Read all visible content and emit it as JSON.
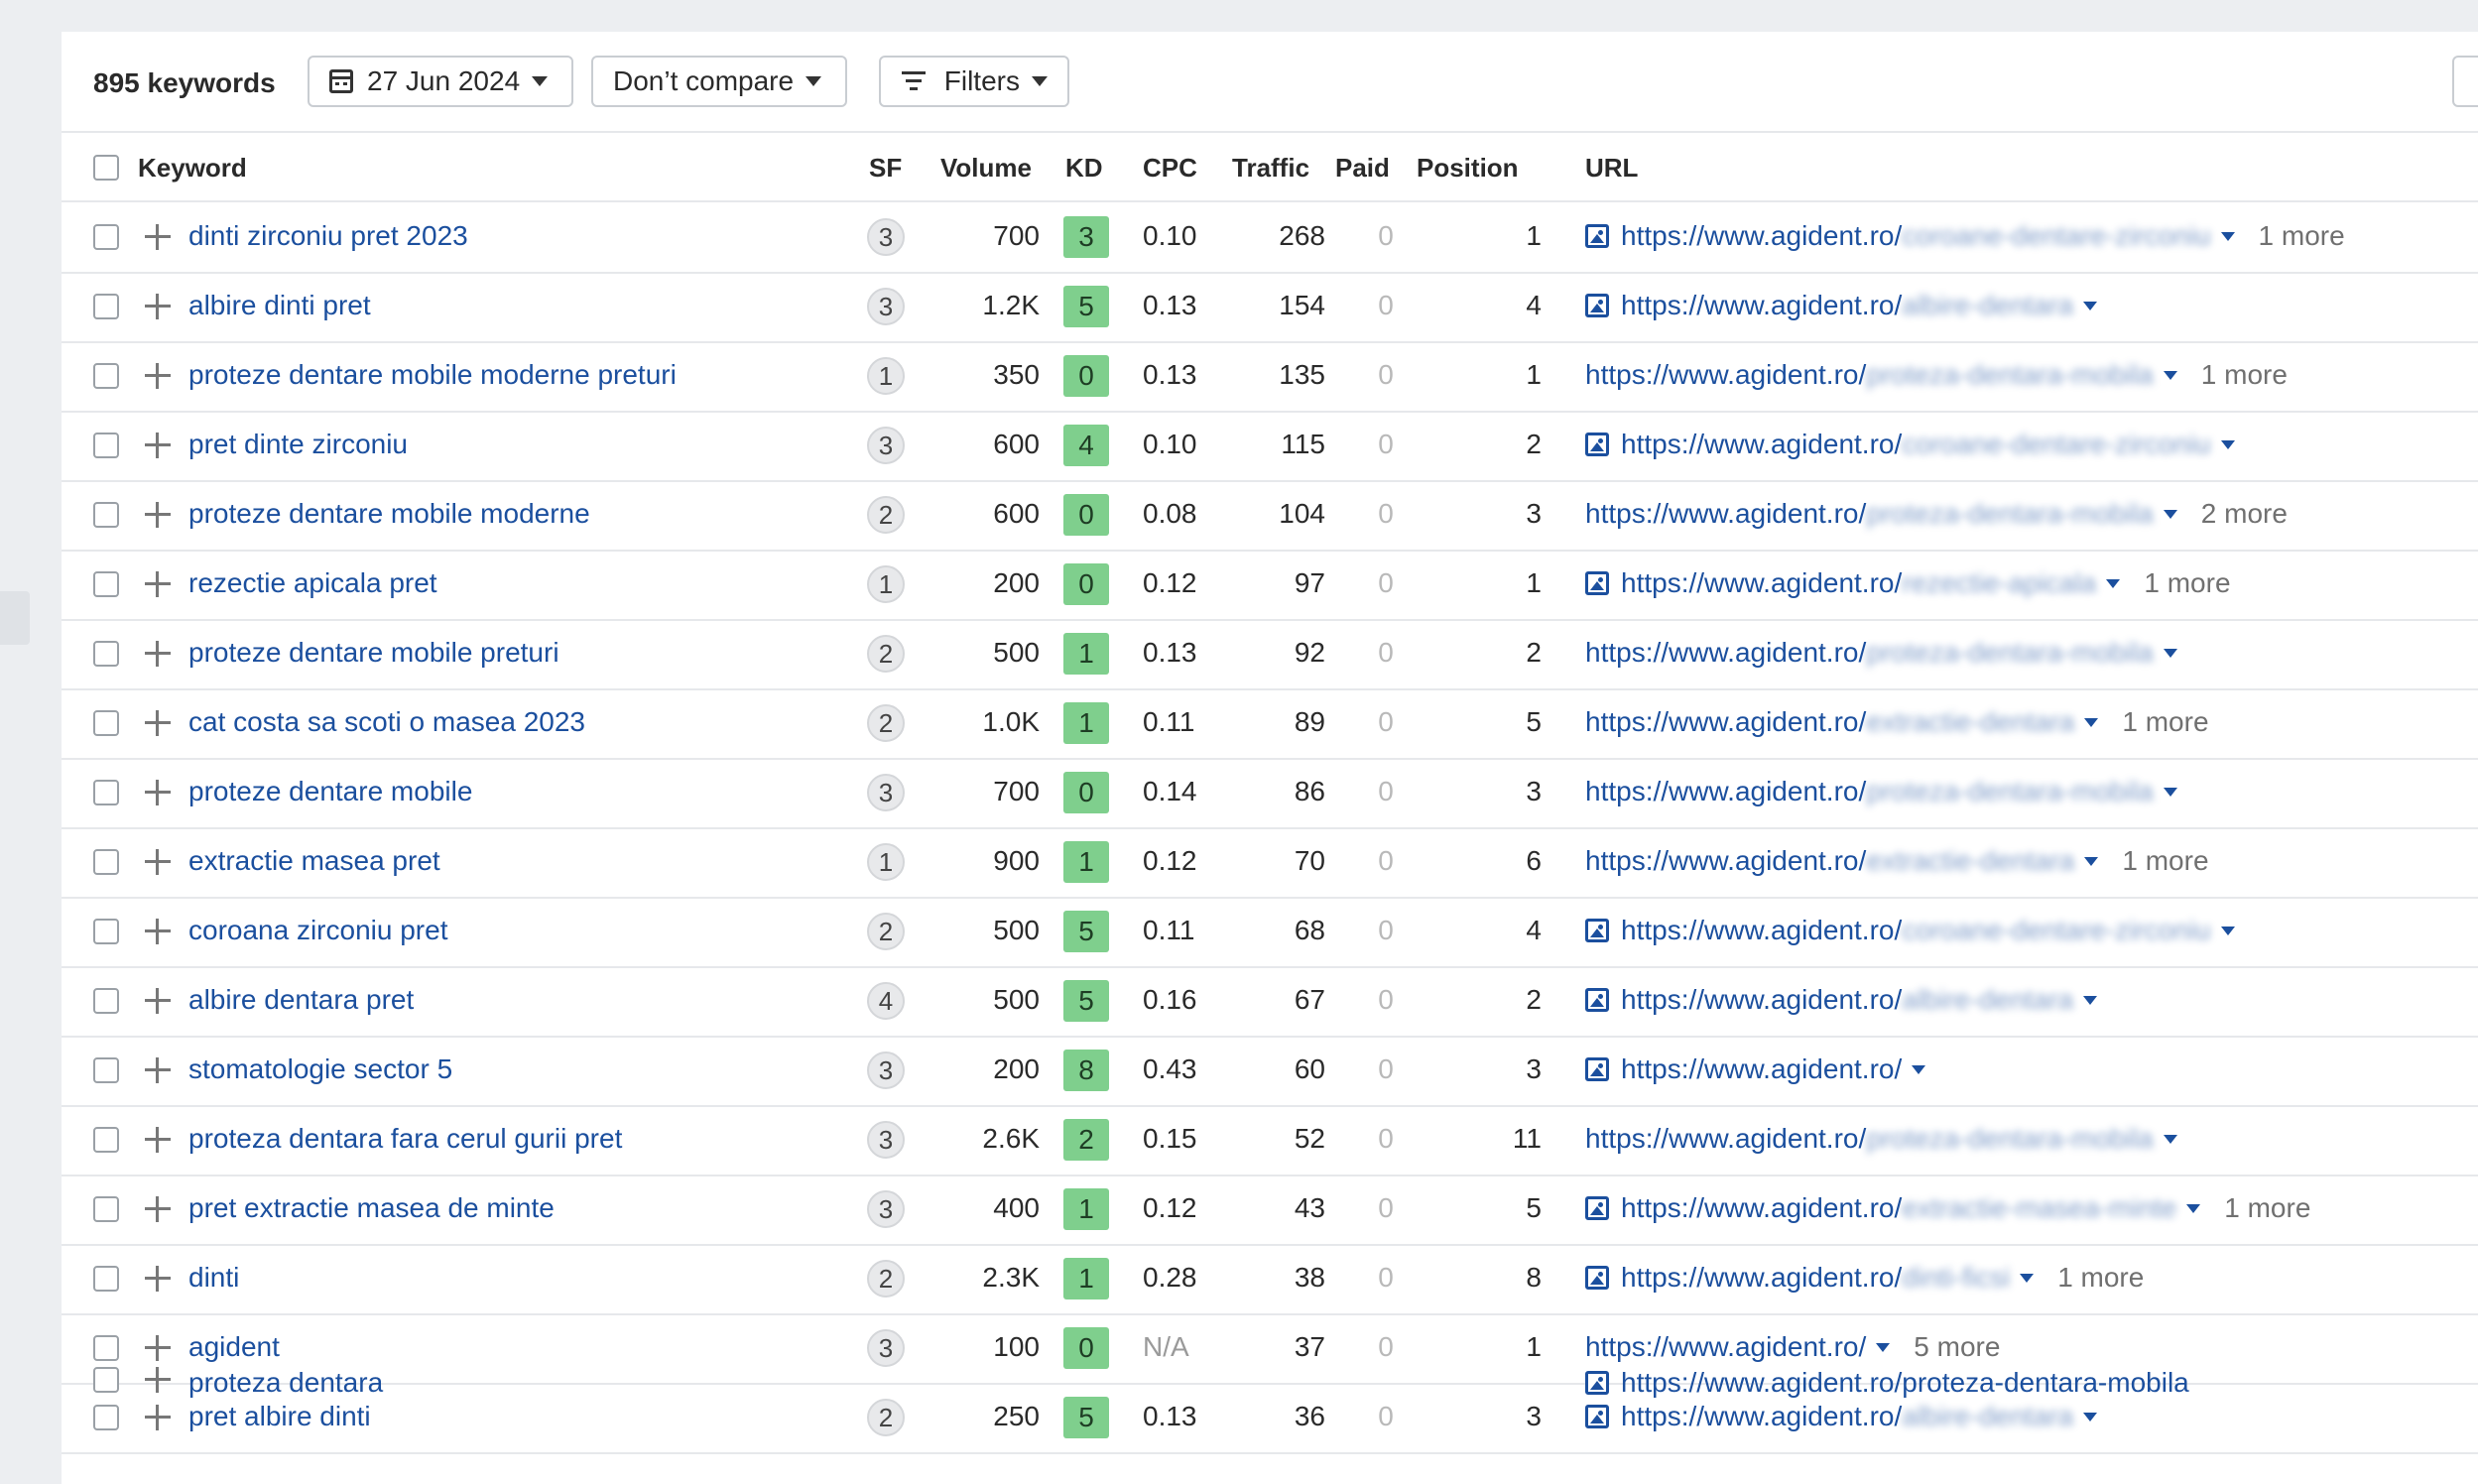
{
  "toolbar": {
    "keyword_count": "895 keywords",
    "date_label": "27 Jun 2024",
    "compare_label": "Don’t compare",
    "filters_label": "Filters"
  },
  "columns": {
    "keyword": "Keyword",
    "sf": "SF",
    "volume": "Volume",
    "kd": "KD",
    "cpc": "CPC",
    "traffic": "Traffic",
    "paid": "Paid",
    "position": "Position",
    "url": "URL"
  },
  "colors": {
    "link": "#1b4f9e",
    "kd_badge": "#7fcf8d"
  },
  "rows": [
    {
      "keyword": "dinti zirconiu pret 2023",
      "sf": "3",
      "volume": "700",
      "kd": "3",
      "cpc": "0.10",
      "traffic": "268",
      "paid": "0",
      "position": "1",
      "has_image": true,
      "url_base": "https://www.agident.ro/",
      "url_path": "coroane-dentare-zirconiu",
      "more": "1 more"
    },
    {
      "keyword": "albire dinti pret",
      "sf": "3",
      "volume": "1.2K",
      "kd": "5",
      "cpc": "0.13",
      "traffic": "154",
      "paid": "0",
      "position": "4",
      "has_image": true,
      "url_base": "https://www.agident.ro/",
      "url_path": "albire-dentara",
      "more": ""
    },
    {
      "keyword": "proteze dentare mobile moderne preturi",
      "sf": "1",
      "volume": "350",
      "kd": "0",
      "cpc": "0.13",
      "traffic": "135",
      "paid": "0",
      "position": "1",
      "has_image": false,
      "url_base": "https://www.agident.ro/",
      "url_path": "proteza-dentara-mobila",
      "more": "1 more"
    },
    {
      "keyword": "pret dinte zirconiu",
      "sf": "3",
      "volume": "600",
      "kd": "4",
      "cpc": "0.10",
      "traffic": "115",
      "paid": "0",
      "position": "2",
      "has_image": true,
      "url_base": "https://www.agident.ro/",
      "url_path": "coroane-dentare-zirconiu",
      "more": ""
    },
    {
      "keyword": "proteze dentare mobile moderne",
      "sf": "2",
      "volume": "600",
      "kd": "0",
      "cpc": "0.08",
      "traffic": "104",
      "paid": "0",
      "position": "3",
      "has_image": false,
      "url_base": "https://www.agident.ro/",
      "url_path": "proteza-dentara-mobila",
      "more": "2 more"
    },
    {
      "keyword": "rezectie apicala pret",
      "sf": "1",
      "volume": "200",
      "kd": "0",
      "cpc": "0.12",
      "traffic": "97",
      "paid": "0",
      "position": "1",
      "has_image": true,
      "url_base": "https://www.agident.ro/",
      "url_path": "rezectie-apicala",
      "more": "1 more"
    },
    {
      "keyword": "proteze dentare mobile preturi",
      "sf": "2",
      "volume": "500",
      "kd": "1",
      "cpc": "0.13",
      "traffic": "92",
      "paid": "0",
      "position": "2",
      "has_image": false,
      "url_base": "https://www.agident.ro/",
      "url_path": "proteza-dentara-mobila",
      "more": ""
    },
    {
      "keyword": "cat costa sa scoti o masea 2023",
      "sf": "2",
      "volume": "1.0K",
      "kd": "1",
      "cpc": "0.11",
      "traffic": "89",
      "paid": "0",
      "position": "5",
      "has_image": false,
      "url_base": "https://www.agident.ro/",
      "url_path": "extractie-dentara",
      "more": "1 more"
    },
    {
      "keyword": "proteze dentare mobile",
      "sf": "3",
      "volume": "700",
      "kd": "0",
      "cpc": "0.14",
      "traffic": "86",
      "paid": "0",
      "position": "3",
      "has_image": false,
      "url_base": "https://www.agident.ro/",
      "url_path": "proteza-dentara-mobila",
      "more": ""
    },
    {
      "keyword": "extractie masea pret",
      "sf": "1",
      "volume": "900",
      "kd": "1",
      "cpc": "0.12",
      "traffic": "70",
      "paid": "0",
      "position": "6",
      "has_image": false,
      "url_base": "https://www.agident.ro/",
      "url_path": "extractie-dentara",
      "more": "1 more"
    },
    {
      "keyword": "coroana zirconiu pret",
      "sf": "2",
      "volume": "500",
      "kd": "5",
      "cpc": "0.11",
      "traffic": "68",
      "paid": "0",
      "position": "4",
      "has_image": true,
      "url_base": "https://www.agident.ro/",
      "url_path": "coroane-dentare-zirconiu",
      "more": ""
    },
    {
      "keyword": "albire dentara pret",
      "sf": "4",
      "volume": "500",
      "kd": "5",
      "cpc": "0.16",
      "traffic": "67",
      "paid": "0",
      "position": "2",
      "has_image": true,
      "url_base": "https://www.agident.ro/",
      "url_path": "albire-dentara",
      "more": ""
    },
    {
      "keyword": "stomatologie sector 5",
      "sf": "3",
      "volume": "200",
      "kd": "8",
      "cpc": "0.43",
      "traffic": "60",
      "paid": "0",
      "position": "3",
      "has_image": true,
      "url_base": "https://www.agident.ro/",
      "url_path": "",
      "more": ""
    },
    {
      "keyword": "proteza dentara fara cerul gurii pret",
      "sf": "3",
      "volume": "2.6K",
      "kd": "2",
      "cpc": "0.15",
      "traffic": "52",
      "paid": "0",
      "position": "11",
      "has_image": false,
      "url_base": "https://www.agident.ro/",
      "url_path": "proteza-dentara-mobila",
      "more": ""
    },
    {
      "keyword": "pret extractie masea de minte",
      "sf": "3",
      "volume": "400",
      "kd": "1",
      "cpc": "0.12",
      "traffic": "43",
      "paid": "0",
      "position": "5",
      "has_image": true,
      "url_base": "https://www.agident.ro/",
      "url_path": "extractie-masea-minte",
      "more": "1 more"
    },
    {
      "keyword": "dinti",
      "sf": "2",
      "volume": "2.3K",
      "kd": "1",
      "cpc": "0.28",
      "traffic": "38",
      "paid": "0",
      "position": "8",
      "has_image": true,
      "url_base": "https://www.agident.ro/",
      "url_path": "dinti-ficsi",
      "more": "1 more"
    },
    {
      "keyword": "agident",
      "sf": "3",
      "volume": "100",
      "kd": "0",
      "cpc": "N/A",
      "traffic": "37",
      "paid": "0",
      "position": "1",
      "has_image": false,
      "url_base": "https://www.agident.ro/",
      "url_path": "",
      "more": "5 more"
    },
    {
      "keyword": "pret albire dinti",
      "sf": "2",
      "volume": "250",
      "kd": "5",
      "cpc": "0.13",
      "traffic": "36",
      "paid": "0",
      "position": "3",
      "has_image": true,
      "url_base": "https://www.agident.ro/",
      "url_path": "albire-dentara",
      "more": ""
    }
  ],
  "partial_row": {
    "keyword": "proteza dentara",
    "url": "https://www.agident.ro/proteza-dentara-mobila"
  }
}
